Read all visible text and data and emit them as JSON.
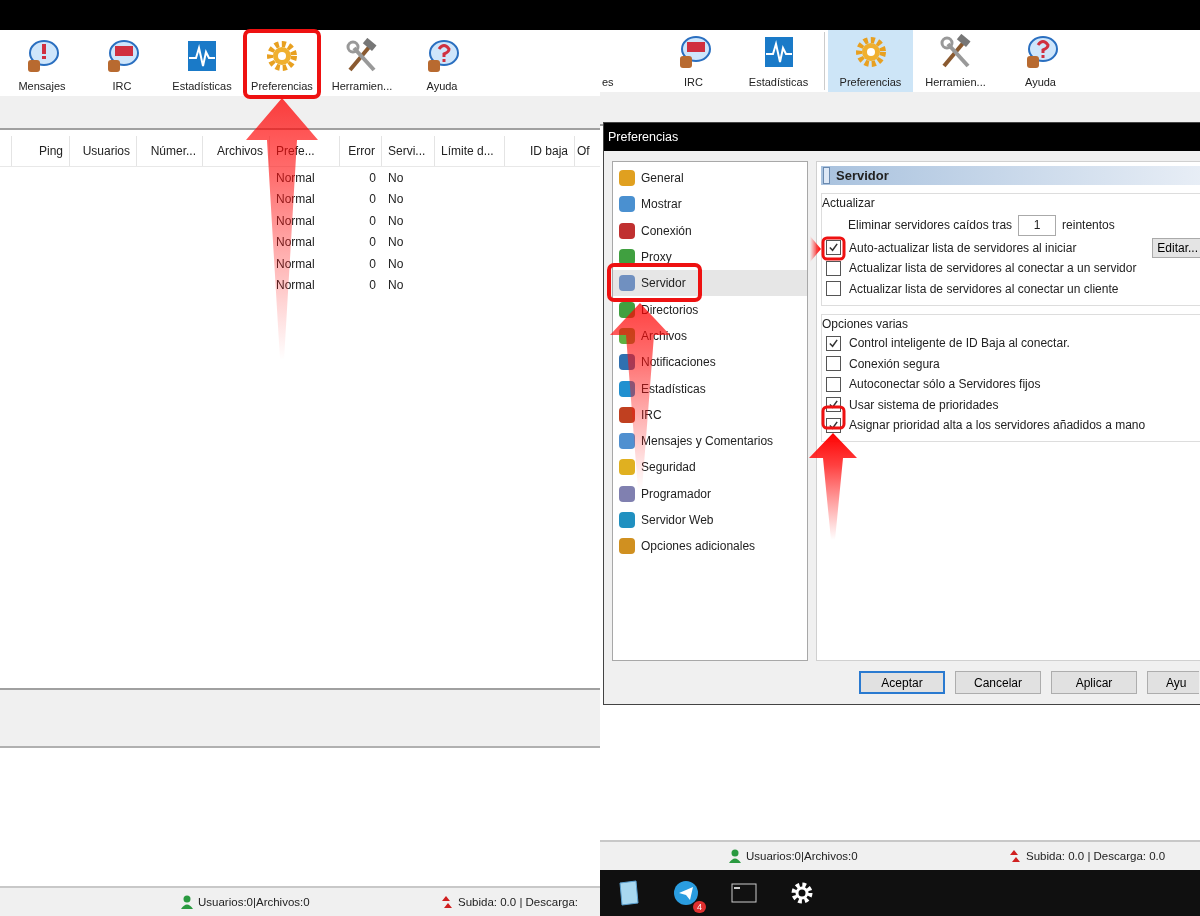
{
  "left_window": {
    "toolbar": [
      {
        "label": "Mensajes",
        "selected": false
      },
      {
        "label": "IRC",
        "selected": false
      },
      {
        "label": "Estadísticas",
        "selected": false
      },
      {
        "label": "Preferencias",
        "selected": false
      },
      {
        "label": "Herramien...",
        "selected": false
      },
      {
        "label": "Ayuda",
        "selected": false
      }
    ],
    "table": {
      "columns": [
        "",
        "Ping",
        "Usuarios",
        "Númer...",
        "Archivos",
        "Prefe...",
        "Error",
        "Servi...",
        "Límite d...",
        "ID baja",
        "Of"
      ],
      "rows": [
        {
          "preference": "Normal",
          "error": "0",
          "server": "No"
        },
        {
          "preference": "Normal",
          "error": "0",
          "server": "No"
        },
        {
          "preference": "Normal",
          "error": "0",
          "server": "No"
        },
        {
          "preference": "Normal",
          "error": "0",
          "server": "No"
        },
        {
          "preference": "Normal",
          "error": "0",
          "server": "No"
        },
        {
          "preference": "Normal",
          "error": "0",
          "server": "No"
        }
      ]
    },
    "status_bar": {
      "users_files": "Usuarios:0|Archivos:0",
      "transfer": "Subida: 0.0 | Descarga:"
    }
  },
  "right_window": {
    "toolbar": [
      {
        "label": "es",
        "selected": false
      },
      {
        "label": "IRC",
        "selected": false
      },
      {
        "label": "Estadísticas",
        "selected": false
      },
      {
        "label": "Preferencias",
        "selected": true
      },
      {
        "label": "Herramien...",
        "selected": false
      },
      {
        "label": "Ayuda",
        "selected": false
      }
    ],
    "dialog": {
      "title": "Preferencias",
      "categories": [
        {
          "label": "General",
          "selected": false
        },
        {
          "label": "Mostrar",
          "selected": false
        },
        {
          "label": "Conexión",
          "selected": false
        },
        {
          "label": "Proxy",
          "selected": false
        },
        {
          "label": "Servidor",
          "selected": true
        },
        {
          "label": "Directorios",
          "selected": false
        },
        {
          "label": "Archivos",
          "selected": false
        },
        {
          "label": "Notificaciones",
          "selected": false
        },
        {
          "label": "Estadísticas",
          "selected": false
        },
        {
          "label": "IRC",
          "selected": false
        },
        {
          "label": "Mensajes y Comentarios",
          "selected": false
        },
        {
          "label": "Seguridad",
          "selected": false
        },
        {
          "label": "Programador",
          "selected": false
        },
        {
          "label": "Servidor Web",
          "selected": false
        },
        {
          "label": "Opciones adicionales",
          "selected": false
        }
      ],
      "panel_title": "Servidor",
      "groups": [
        {
          "title": "Actualizar",
          "retry": {
            "before": "Eliminar servidores caídos tras",
            "value": "1",
            "after": "reintentos"
          },
          "options": [
            {
              "label": "Auto-actualizar lista de servidores al iniciar",
              "checked": true,
              "button": "Editar..."
            },
            {
              "label": "Actualizar lista de servidores al conectar a un servidor",
              "checked": false
            },
            {
              "label": "Actualizar lista de servidores al conectar un cliente",
              "checked": false
            }
          ]
        },
        {
          "title": "Opciones varias",
          "options": [
            {
              "label": "Control inteligente de ID Baja al conectar.",
              "checked": true
            },
            {
              "label": "Conexión segura",
              "checked": false
            },
            {
              "label": "Autoconectar sólo a Servidores fijos",
              "checked": false
            },
            {
              "label": "Usar sistema de prioridades",
              "checked": true
            },
            {
              "label": "Asignar prioridad alta a los servidores añadidos a mano",
              "checked": true
            }
          ]
        }
      ],
      "buttons": [
        {
          "label": "Aceptar",
          "default": true
        },
        {
          "label": "Cancelar",
          "default": false
        },
        {
          "label": "Aplicar",
          "default": false
        },
        {
          "label": "Ayu",
          "default": false
        }
      ]
    },
    "status_bar": {
      "users_files": "Usuarios:0|Archivos:0",
      "transfer": "Subida: 0.0 | Descarga: 0.0"
    },
    "taskbar": {
      "badge": "4"
    }
  }
}
